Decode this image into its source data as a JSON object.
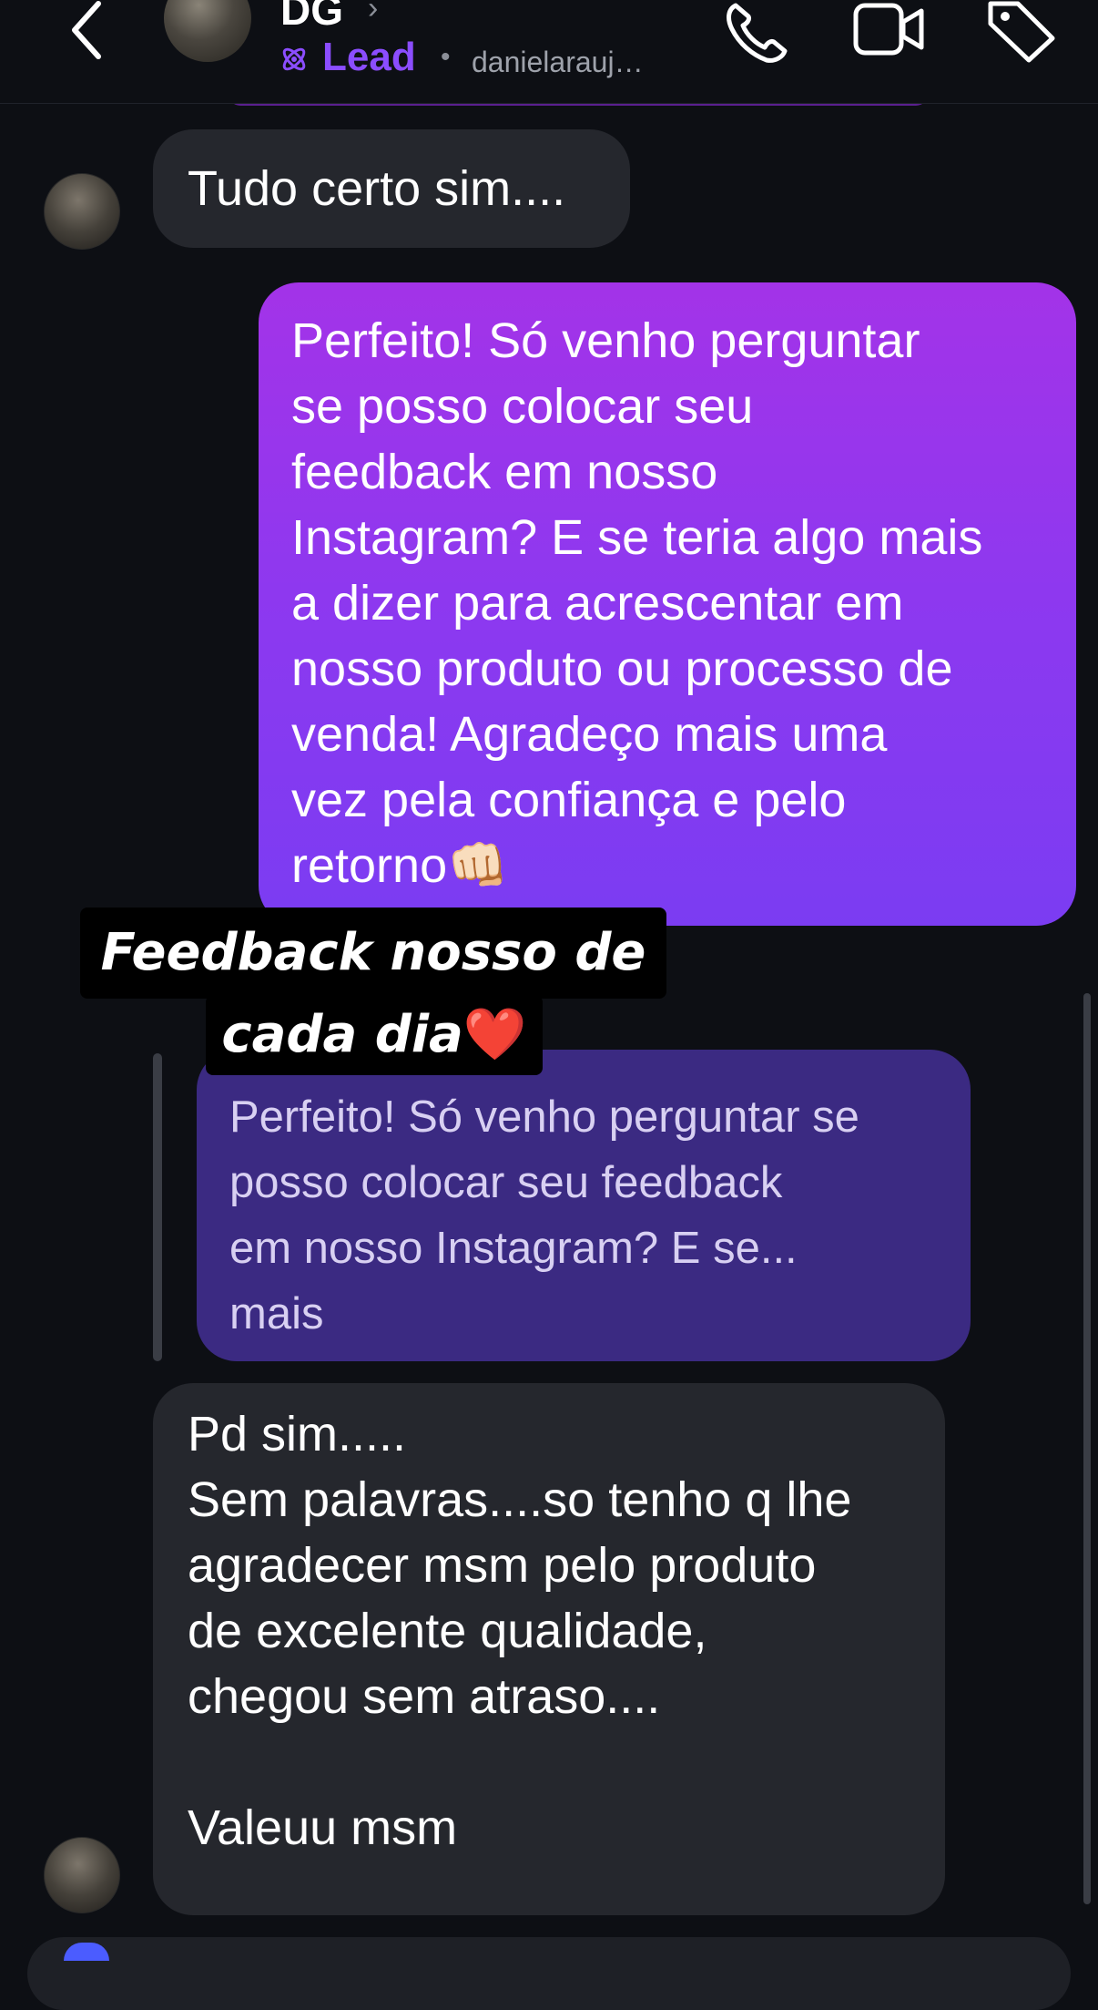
{
  "header": {
    "contact_name": "DG",
    "label": "Lead",
    "username": "danielarauj…",
    "icons": {
      "back": "back-chevron-icon",
      "chevron": "chevron-right-icon",
      "lead": "lead-icon",
      "phone": "phone-icon",
      "video": "video-camera-icon",
      "tag": "tag-icon"
    },
    "chevron_glyph": "›",
    "dot": "•"
  },
  "messages": [
    {
      "from": "contact",
      "text": "Tudo certo sim...."
    },
    {
      "from": "me",
      "text": "Perfeito! Só venho perguntar\nse posso colocar seu\nfeedback em nosso\nInstagram? E se teria algo mais\na dizer para acrescentar em\nnosso produto ou processo de\nvenda! Agradeço mais uma\nvez pela confiança e pelo\nretorno👊🏻"
    },
    {
      "from": "quote",
      "text": "Perfeito! Só venho perguntar se\nposso colocar seu feedback\nem nosso Instagram? E se...\nmais"
    },
    {
      "from": "contact",
      "text": "Pd sim.....\nSem palavras....so tenho q lhe\nagradecer msm pelo produto\nde excelente qualidade,\nchegou sem atraso....\n\nValeuu msm"
    }
  ],
  "sticker": {
    "line1": "Feedback nosso de",
    "line2": "cada dia",
    "emoji": "❤️"
  },
  "colors": {
    "background": "#0d0f14",
    "incoming_bubble": "#25272d",
    "outgoing_gradient_top": "#a333e8",
    "outgoing_gradient_bottom": "#7b3cf2",
    "quote_bubble": "#3b2a82",
    "lead_accent": "#8b4dff"
  }
}
